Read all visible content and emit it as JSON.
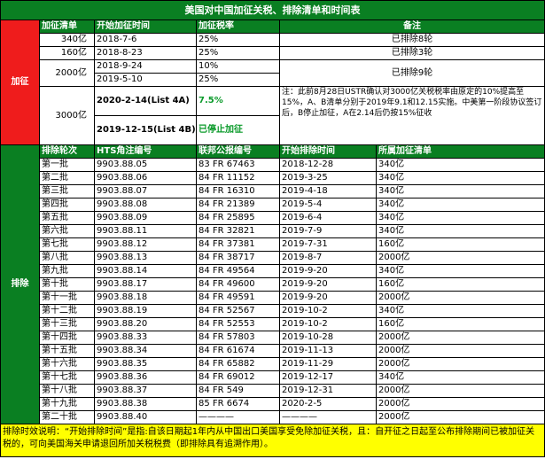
{
  "title": "美国对中国加征关税、排除清单和时间表",
  "colors": {
    "header_green": "#0a7f22",
    "side_red": "#ef1c1c",
    "footer_yellow": "#ffff00",
    "accent_green": "#0a9a2a"
  },
  "tariff": {
    "side_label": "加征",
    "headers": {
      "list": "加征清单",
      "start": "开始加征时间",
      "rate": "加征税率",
      "note": "备注"
    },
    "rows": [
      {
        "list": "340亿",
        "start": "2018-7-6",
        "rate": "25%"
      },
      {
        "list": "160亿",
        "start": "2018-8-23",
        "rate": "25%"
      },
      {
        "list": "2000亿",
        "start": "2018-9-24",
        "rate": "10%"
      },
      {
        "start": "2019-5-10",
        "rate": "25%"
      },
      {
        "list": "3000亿",
        "start": "2020-2-14(List 4A)",
        "rate": "7.5%"
      },
      {
        "start": "2019-12-15(List 4B)",
        "rate": "已停止加征"
      }
    ],
    "notes": {
      "n340": "已排除8轮",
      "n160": "已排除3轮",
      "n2000": "已排除9轮",
      "n3000": "注：此前8月28日USTR确认对3000亿关税税率由原定的10%提高至15%，A、B清单分别于2019年9.1和12.15实施。中美第一阶段协议签订后，B停止加征，A在2.14后仍按15%征收"
    }
  },
  "exclusion": {
    "side_label": "排除",
    "headers": {
      "round": "排除轮次",
      "hts": "HTS角注编号",
      "fr": "联邦公报编号",
      "start": "开始排除时间",
      "list": "所属加征清单"
    },
    "rows": [
      {
        "round": "第一批",
        "hts": "9903.88.05",
        "fr": "83 FR 67463",
        "start": "2018-12-28",
        "list": "340亿"
      },
      {
        "round": "第二批",
        "hts": "9903.88.06",
        "fr": "84 FR 11152",
        "start": "2019-3-25",
        "list": "340亿"
      },
      {
        "round": "第三批",
        "hts": "9903.88.07",
        "fr": "84 FR 16310",
        "start": "2019-4-18",
        "list": "340亿"
      },
      {
        "round": "第四批",
        "hts": "9903.88.08",
        "fr": "84 FR 21389",
        "start": "2019-5-4",
        "list": "340亿"
      },
      {
        "round": "第五批",
        "hts": "9903.88.09",
        "fr": "84 FR 25895",
        "start": "2019-6-4",
        "list": "340亿"
      },
      {
        "round": "第六批",
        "hts": "9903.88.11",
        "fr": "84 FR 32821",
        "start": "2019-7-9",
        "list": "340亿"
      },
      {
        "round": "第七批",
        "hts": "9903.88.12",
        "fr": "84 FR 37381",
        "start": "2019-7-31",
        "list": "160亿"
      },
      {
        "round": "第八批",
        "hts": "9903.88.13",
        "fr": "84 FR 38717",
        "start": "2019-8-7",
        "list": "2000亿"
      },
      {
        "round": "第九批",
        "hts": "9903.88.14",
        "fr": "84 FR 49564",
        "start": "2019-9-20",
        "list": "340亿"
      },
      {
        "round": "第十批",
        "hts": "9903.88.17",
        "fr": "84 FR 49600",
        "start": "2019-9-20",
        "list": "160亿"
      },
      {
        "round": "第十一批",
        "hts": "9903.88.18",
        "fr": "84 FR 49591",
        "start": "2019-9-20",
        "list": "2000亿"
      },
      {
        "round": "第十二批",
        "hts": "9903.88.19",
        "fr": "84 FR 52567",
        "start": "2019-10-2",
        "list": "340亿"
      },
      {
        "round": "第十三批",
        "hts": "9903.88.20",
        "fr": "84 FR 52553",
        "start": "2019-10-2",
        "list": "160亿"
      },
      {
        "round": "第十四批",
        "hts": "9903.88.33",
        "fr": "84 FR 57803",
        "start": "2019-10-28",
        "list": "2000亿"
      },
      {
        "round": "第十五批",
        "hts": "9903.88.34",
        "fr": "84 FR 61674",
        "start": "2019-11-13",
        "list": "2000亿"
      },
      {
        "round": "第十六批",
        "hts": "9903.88.35",
        "fr": "84 FR 65882",
        "start": "2019-11-29",
        "list": "2000亿"
      },
      {
        "round": "第十七批",
        "hts": "9903.88.36",
        "fr": "84 FR 69012",
        "start": "2019-12-17",
        "list": "340亿"
      },
      {
        "round": "第十八批",
        "hts": "9903.88.37",
        "fr": "84 FR 549",
        "start": "2019-12-31",
        "list": "2000亿"
      },
      {
        "round": "第十九批",
        "hts": "9903.88.38",
        "fr": "85 FR 6674",
        "start": "2020-2-5",
        "list": "2000亿"
      },
      {
        "round": "第二十批",
        "hts": "9903.88.40",
        "fr": "————",
        "start": "————",
        "list": "2000亿"
      }
    ]
  },
  "footer": "排除时效说明：“开始排除时间”是指:自该日期起1年内从中国出口美国享受免除加征关税，且：自开征之日起至公布排除期间已被加征关税的，可向美国海关申请退回所加关税税费（即排除具有追溯作用）。"
}
